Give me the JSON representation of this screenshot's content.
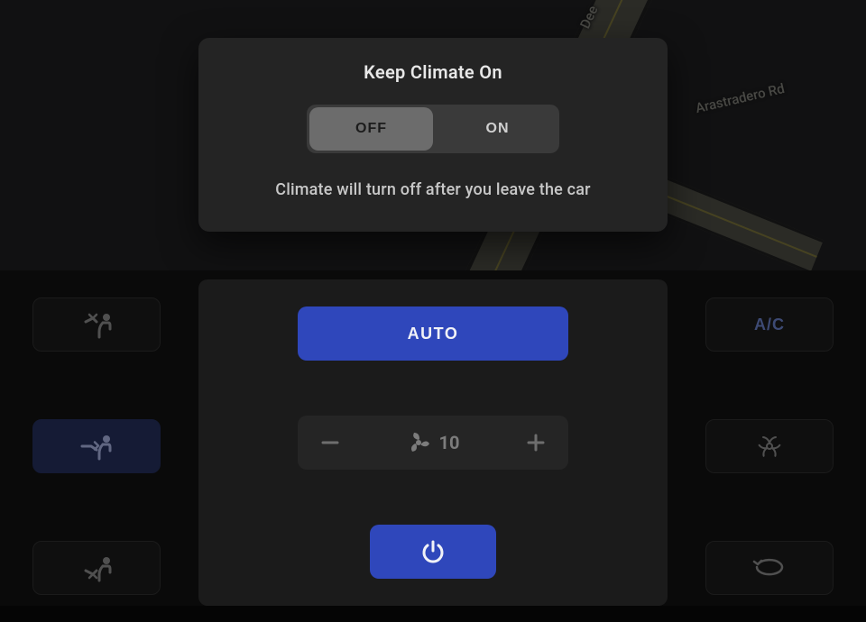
{
  "map": {
    "road_label_1": "Dee",
    "road_label_2": "Arastradero Rd"
  },
  "popup": {
    "title": "Keep Climate On",
    "off_label": "OFF",
    "on_label": "ON",
    "active": "off",
    "caption": "Climate will turn off after you leave the car"
  },
  "climate": {
    "auto_label": "AUTO",
    "fan_speed": "10",
    "ac_label": "A/C",
    "airflow": {
      "face": {
        "active": false
      },
      "body": {
        "active": true
      },
      "feet": {
        "active": false
      }
    },
    "biohazard_active": false,
    "recirc_active": false
  },
  "colors": {
    "accent_blue": "#2f47bb",
    "accent_blue_muted": "#26315f",
    "panel": "#1b1b1b",
    "popup_bg": "#242424"
  }
}
